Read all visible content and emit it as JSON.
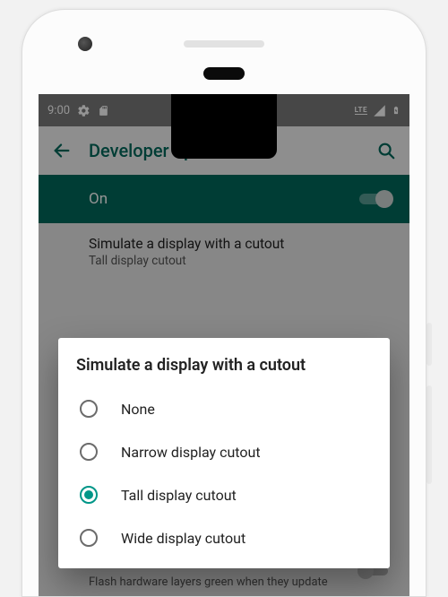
{
  "statusbar": {
    "time": "9:00",
    "lte_label": "LTE"
  },
  "appbar": {
    "title": "Developer options"
  },
  "master_toggle": {
    "label": "On",
    "enabled": true
  },
  "current_setting": {
    "title": "Simulate a display with a cutout",
    "subtitle": "Tall display cutout"
  },
  "dialog": {
    "title": "Simulate a display with a cutout",
    "options": [
      {
        "label": "None",
        "selected": false
      },
      {
        "label": "Narrow display cutout",
        "selected": false
      },
      {
        "label": "Tall display cutout",
        "selected": true
      },
      {
        "label": "Wide display cutout",
        "selected": false
      }
    ]
  },
  "peek_setting": {
    "text": "Flash hardware layers green when they update"
  },
  "colors": {
    "accent": "#009688",
    "appbar_teal": "#00695c"
  }
}
